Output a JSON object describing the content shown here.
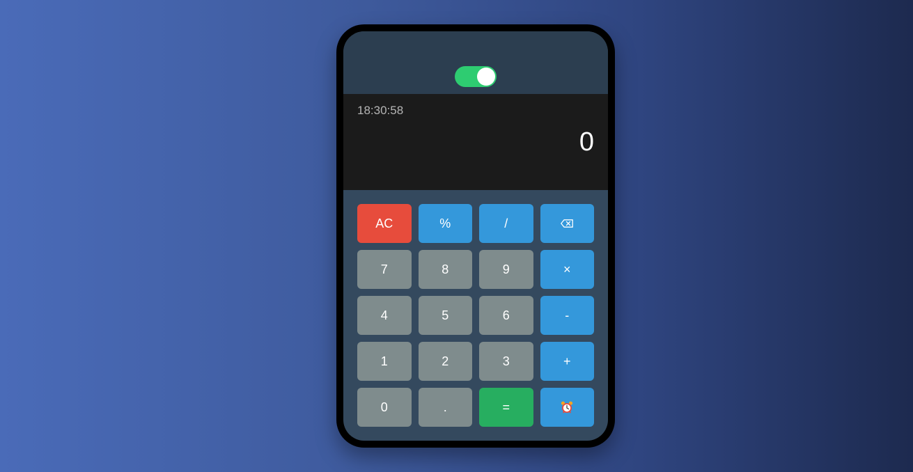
{
  "theme_toggle": {
    "state": "on",
    "color": "#2ecc71"
  },
  "display": {
    "time": "18:30:58",
    "value": "0"
  },
  "keys": {
    "ac": "AC",
    "percent": "%",
    "divide": "/",
    "backspace_icon": "backspace-icon",
    "seven": "7",
    "eight": "8",
    "nine": "9",
    "multiply": "×",
    "four": "4",
    "five": "5",
    "six": "6",
    "minus": "-",
    "one": "1",
    "two": "2",
    "three": "3",
    "plus": "+",
    "zero": "0",
    "decimal": ".",
    "equals": "=",
    "alarm_icon": "alarm-clock-icon"
  },
  "colors": {
    "number_key": "#7f8c8d",
    "operator_key": "#3498db",
    "clear_key": "#e74c3c",
    "equals_key": "#27ae60",
    "display_bg": "#1b1b1b"
  }
}
